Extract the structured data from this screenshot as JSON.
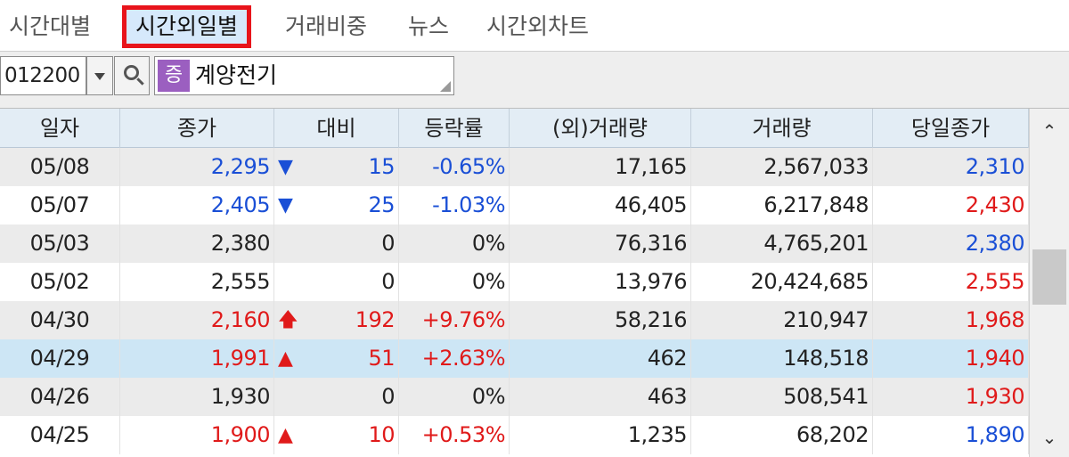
{
  "tabs": [
    {
      "label": "시간대별",
      "active": false
    },
    {
      "label": "시간외일별",
      "active": true
    },
    {
      "label": "거래비중",
      "active": false
    },
    {
      "label": "뉴스",
      "active": false
    },
    {
      "label": "시간외차트",
      "active": false
    }
  ],
  "toolbar": {
    "stock_code": "012200",
    "badge": "증",
    "stock_name": "계양전기"
  },
  "colors": {
    "up": "#e01a1a",
    "down": "#1a4fd6",
    "selected_row": "#cde6f5",
    "active_tab_border": "#e8141b",
    "badge": "#9b5fc0"
  },
  "table": {
    "columns": [
      "일자",
      "종가",
      "대비",
      "등락률",
      "(외)거래량",
      "거래량",
      "당일종가"
    ],
    "rows": [
      {
        "date": "05/08",
        "close": "2,295",
        "dir": "down",
        "symbol": "▼",
        "change": "15",
        "rate": "-0.65%",
        "ovol": "17,165",
        "vol": "2,567,033",
        "day_close": "2,310",
        "day_close_color": "blue"
      },
      {
        "date": "05/07",
        "close": "2,405",
        "dir": "down",
        "symbol": "▼",
        "change": "25",
        "rate": "-1.03%",
        "ovol": "46,405",
        "vol": "6,217,848",
        "day_close": "2,430",
        "day_close_color": "red"
      },
      {
        "date": "05/03",
        "close": "2,380",
        "dir": "flat",
        "symbol": "",
        "change": "0",
        "rate": "0%",
        "ovol": "76,316",
        "vol": "4,765,201",
        "day_close": "2,380",
        "day_close_color": "blue"
      },
      {
        "date": "05/02",
        "close": "2,555",
        "dir": "flat",
        "symbol": "",
        "change": "0",
        "rate": "0%",
        "ovol": "13,976",
        "vol": "20,424,685",
        "day_close": "2,555",
        "day_close_color": "red"
      },
      {
        "date": "04/30",
        "close": "2,160",
        "dir": "upper",
        "symbol": "🡅",
        "change": "192",
        "rate": "+9.76%",
        "ovol": "58,216",
        "vol": "210,947",
        "day_close": "1,968",
        "day_close_color": "red"
      },
      {
        "date": "04/29",
        "close": "1,991",
        "dir": "up",
        "symbol": "▲",
        "change": "51",
        "rate": "+2.63%",
        "ovol": "462",
        "vol": "148,518",
        "day_close": "1,940",
        "day_close_color": "red"
      },
      {
        "date": "04/26",
        "close": "1,930",
        "dir": "flat",
        "symbol": "",
        "change": "0",
        "rate": "0%",
        "ovol": "463",
        "vol": "508,541",
        "day_close": "1,930",
        "day_close_color": "red"
      },
      {
        "date": "04/25",
        "close": "1,900",
        "dir": "up",
        "symbol": "▲",
        "change": "10",
        "rate": "+0.53%",
        "ovol": "1,235",
        "vol": "68,202",
        "day_close": "1,890",
        "day_close_color": "blue"
      }
    ]
  }
}
